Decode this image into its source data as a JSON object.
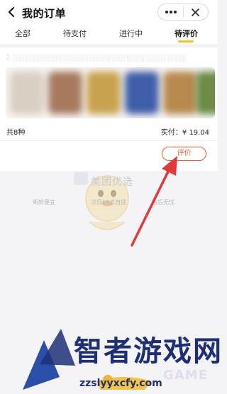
{
  "header": {
    "title": "我的订单",
    "back_icon": "chevron-left-icon",
    "more_icon": "more-horizontal-icon",
    "close_icon": "close-icon"
  },
  "tabs": [
    {
      "label": "全部",
      "active": false
    },
    {
      "label": "待支付",
      "active": false
    },
    {
      "label": "进行中",
      "active": false
    },
    {
      "label": "待评价",
      "active": true
    }
  ],
  "order": {
    "item_count_label": "共8种",
    "paid_label": "实付：¥ 19.04",
    "review_button_label": "评价"
  },
  "watermark": {
    "brand": "美团优选",
    "badges": [
      "新鲜便宜",
      "次日16点自提",
      "售后无忧"
    ]
  },
  "site_watermark": {
    "name": "智者游戏网",
    "domain": "zzslyyxcfy.com",
    "game": "GAME"
  },
  "colors": {
    "accent": "#f8c515",
    "review": "#f05a2b",
    "arrow": "#e23a3a"
  }
}
